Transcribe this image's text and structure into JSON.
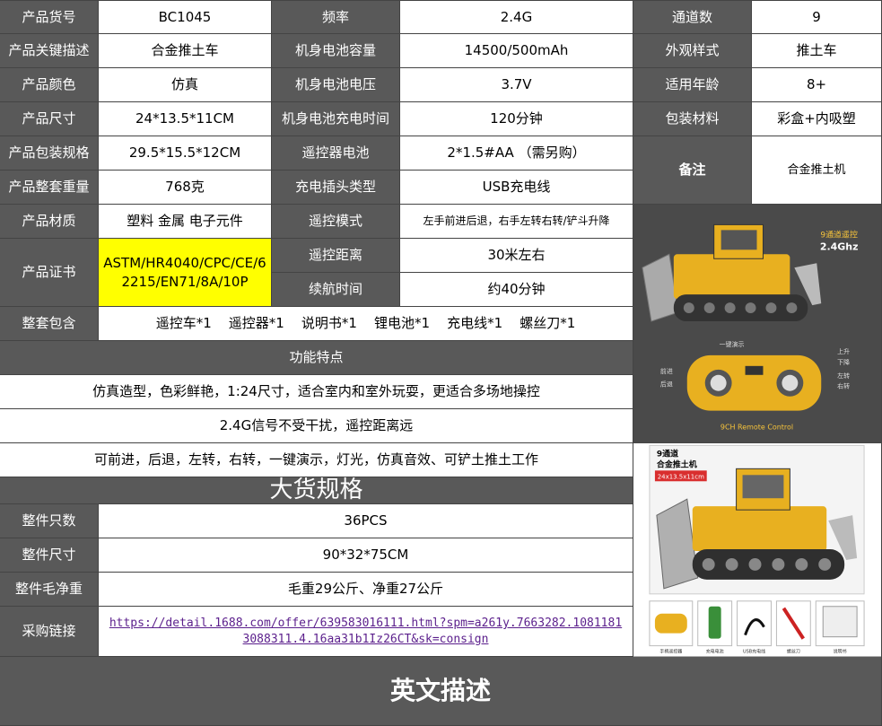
{
  "rows": [
    [
      {
        "label": "产品货号",
        "value": "BC1045"
      },
      {
        "label": "频率",
        "value": "2.4G"
      },
      {
        "label": "通道数",
        "value": "9"
      }
    ],
    [
      {
        "label": "产品关键描述",
        "value": "合金推土车"
      },
      {
        "label": "机身电池容量",
        "value": "14500/500mAh"
      },
      {
        "label": "外观样式",
        "value": "推土车"
      }
    ],
    [
      {
        "label": "产品颜色",
        "value": "仿真"
      },
      {
        "label": "机身电池电压",
        "value": "3.7V"
      },
      {
        "label": "适用年龄",
        "value": "8+"
      }
    ],
    [
      {
        "label": "产品尺寸",
        "value": "24*13.5*11CM"
      },
      {
        "label": "机身电池充电时间",
        "value": "120分钟"
      },
      {
        "label": "包装材料",
        "value": "彩盒+内吸塑"
      }
    ],
    [
      {
        "label": "产品包装规格",
        "value": "29.5*15.5*12CM"
      },
      {
        "label": "遥控器电池",
        "value": "2*1.5#AA （需另购）"
      }
    ],
    [
      {
        "label": "产品整套重量",
        "value": "768克"
      },
      {
        "label": "充电插头类型",
        "value": "USB充电线"
      }
    ],
    [
      {
        "label": "产品材质",
        "value": "塑料 金属 电子元件"
      },
      {
        "label": "遥控模式",
        "value": "左手前进后退，右手左转右转/铲斗升降"
      }
    ]
  ],
  "remark": {
    "label": "备注",
    "value": "合金推土机"
  },
  "cert": {
    "label": "产品证书",
    "value": "ASTM/HR4040/CPC/CE/62215/EN71/8A/10P"
  },
  "remote_distance": {
    "label": "遥控距离",
    "value": "30米左右"
  },
  "endurance": {
    "label": "续航时间",
    "value": "约40分钟"
  },
  "package": {
    "label": "整套包含",
    "value": "遥控车*1    遥控器*1    说明书*1    锂电池*1    充电线*1    螺丝刀*1"
  },
  "features": {
    "title": "功能特点",
    "lines": [
      "仿真造型，色彩鲜艳，1:24尺寸，适合室内和室外玩耍，更适合多场地操控",
      "2.4G信号不受干扰，遥控距离远",
      "可前进，后退，左转，右转，一键演示，灯光，仿真音效、可铲土推土工作"
    ]
  },
  "bulk": {
    "title": "大货规格",
    "rows": [
      {
        "label": "整件只数",
        "value": "36PCS"
      },
      {
        "label": "整件尺寸",
        "value": "90*32*75CM"
      },
      {
        "label": "整件毛净重",
        "value": "毛重29公斤、净重27公斤"
      },
      {
        "label": "采购链接",
        "value": "https://detail.1688.com/offer/639583016111.html?spm=a261y.7663282.1081181 3088311.4.16aa31b1Iz26CT&sk=consign"
      }
    ]
  },
  "footer": {
    "title": "英文描述"
  },
  "image1": {
    "badge_line1": "9通道遥控",
    "badge_line2": "2.4Ghz",
    "remote_caption": "9CH Remote Control",
    "callouts": [
      "一键演示",
      "上升",
      "下降",
      "前进",
      "后退",
      "左转",
      "右转"
    ]
  },
  "image2": {
    "title_line1": "9通道",
    "title_line2": "合金推土机",
    "size_tag": "24x13.5x11cm",
    "thumb_labels": [
      "手柄遥控器",
      "充电电池",
      "USB充电线",
      "螺丝刀",
      "说明书"
    ]
  },
  "colors": {
    "header_bg": "#595959",
    "highlight": "#ffff00",
    "link": "#5b1f8c",
    "machine": "#e8b020"
  }
}
